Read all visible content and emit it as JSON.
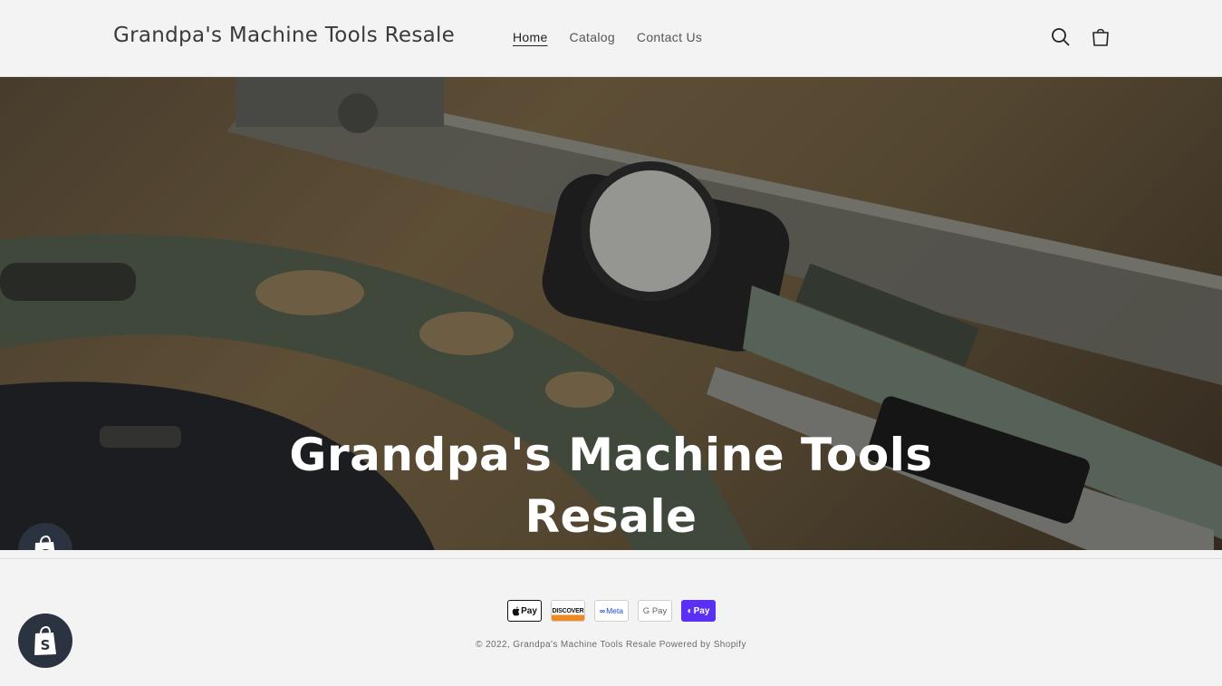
{
  "header": {
    "store_name": "Grandpa's Machine Tools Resale",
    "nav": [
      {
        "label": "Home",
        "active": true
      },
      {
        "label": "Catalog",
        "active": false
      },
      {
        "label": "Contact Us",
        "active": false
      }
    ],
    "icons": [
      "search-icon",
      "cart-icon"
    ]
  },
  "hero": {
    "title": "Grandpa's Machine Tools Resale"
  },
  "footer": {
    "payment_methods": [
      {
        "name": "Apple Pay",
        "label": "Pay",
        "icon": "apple-icon"
      },
      {
        "name": "Discover",
        "label": "DISCOVER"
      },
      {
        "name": "Meta Pay",
        "label": "Meta",
        "icon": "meta-icon"
      },
      {
        "name": "Google Pay",
        "label": "G Pay"
      },
      {
        "name": "Shop Pay",
        "label": "Pay",
        "icon": "shop-icon"
      }
    ],
    "copyright": "© 2022, Grandpa's Machine Tools Resale Powered by Shopify"
  },
  "colors": {
    "background": "#f3f3f3",
    "shop_pay": "#5a31f4",
    "badge": "#2b3340"
  }
}
